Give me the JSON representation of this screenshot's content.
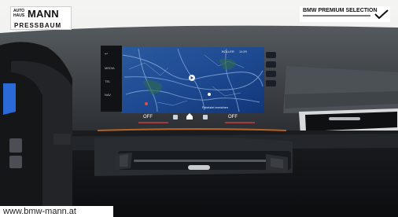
{
  "dealer": {
    "small_text": "AUTO HAUS",
    "name": "MANN",
    "city": "PRESSBAUM"
  },
  "premium": {
    "title": "BMW PREMIUM SELECTION"
  },
  "screen": {
    "side_menu": [
      "MEDIA",
      "TEL",
      "NAV"
    ],
    "top_status": "BOLLER",
    "time": "11:29",
    "route_info": "Fahrtziel erreichen",
    "climate_left": "OFF",
    "climate_right": "OFF"
  },
  "website": "www.bmw-mann.at"
}
